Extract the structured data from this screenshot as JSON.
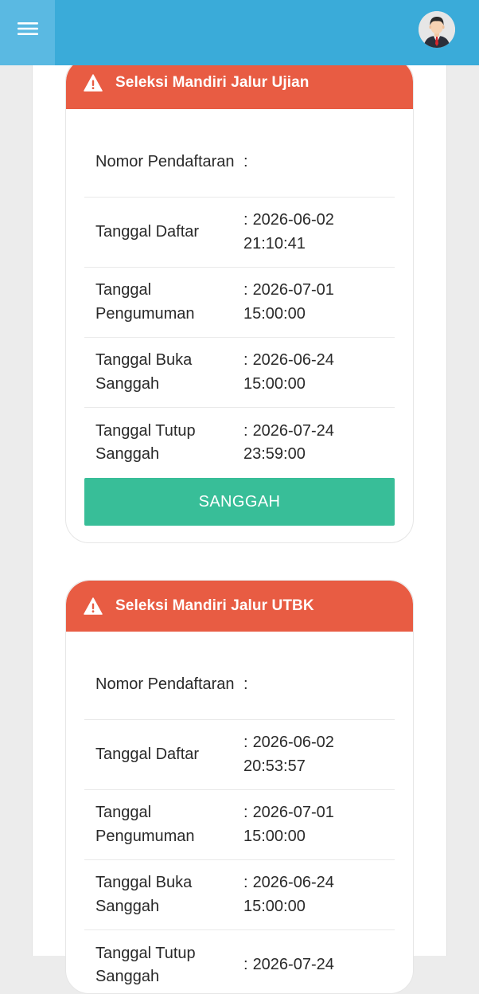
{
  "header": {
    "menu_icon": "hamburger-menu-icon",
    "avatar_icon": "user-avatar-icon"
  },
  "colors": {
    "topbar": "#3aabd9",
    "card_header": "#e85c43",
    "button": "#38be98"
  },
  "cards": [
    {
      "title": "Seleksi Mandiri Jalur Ujian",
      "icon": "warning-icon",
      "rows": [
        {
          "label": "Nomor Pendaftaran",
          "sep": ":",
          "value": ""
        },
        {
          "label": "Tanggal Daftar",
          "sep": ":",
          "value": "2026-06-02 21:10:41"
        },
        {
          "label": "Tanggal Pengumuman",
          "sep": ":",
          "value": "2026-07-01 15:00:00"
        },
        {
          "label": "Tanggal Buka Sanggah",
          "sep": ":",
          "value": "2026-06-24 15:00:00"
        },
        {
          "label": "Tanggal Tutup Sanggah",
          "sep": ":",
          "value": "2026-07-24 23:59:00"
        }
      ],
      "button_label": "SANGGAH"
    },
    {
      "title": "Seleksi Mandiri Jalur UTBK",
      "icon": "warning-icon",
      "rows": [
        {
          "label": "Nomor Pendaftaran",
          "sep": ":",
          "value": ""
        },
        {
          "label": "Tanggal Daftar",
          "sep": ":",
          "value": "2026-06-02 20:53:57"
        },
        {
          "label": "Tanggal Pengumuman",
          "sep": ":",
          "value": "2026-07-01 15:00:00"
        },
        {
          "label": "Tanggal Buka Sanggah",
          "sep": ":",
          "value": "2026-06-24 15:00:00"
        },
        {
          "label": "Tanggal Tutup Sanggah",
          "sep": ":",
          "value": "2026-07-24"
        }
      ]
    }
  ]
}
